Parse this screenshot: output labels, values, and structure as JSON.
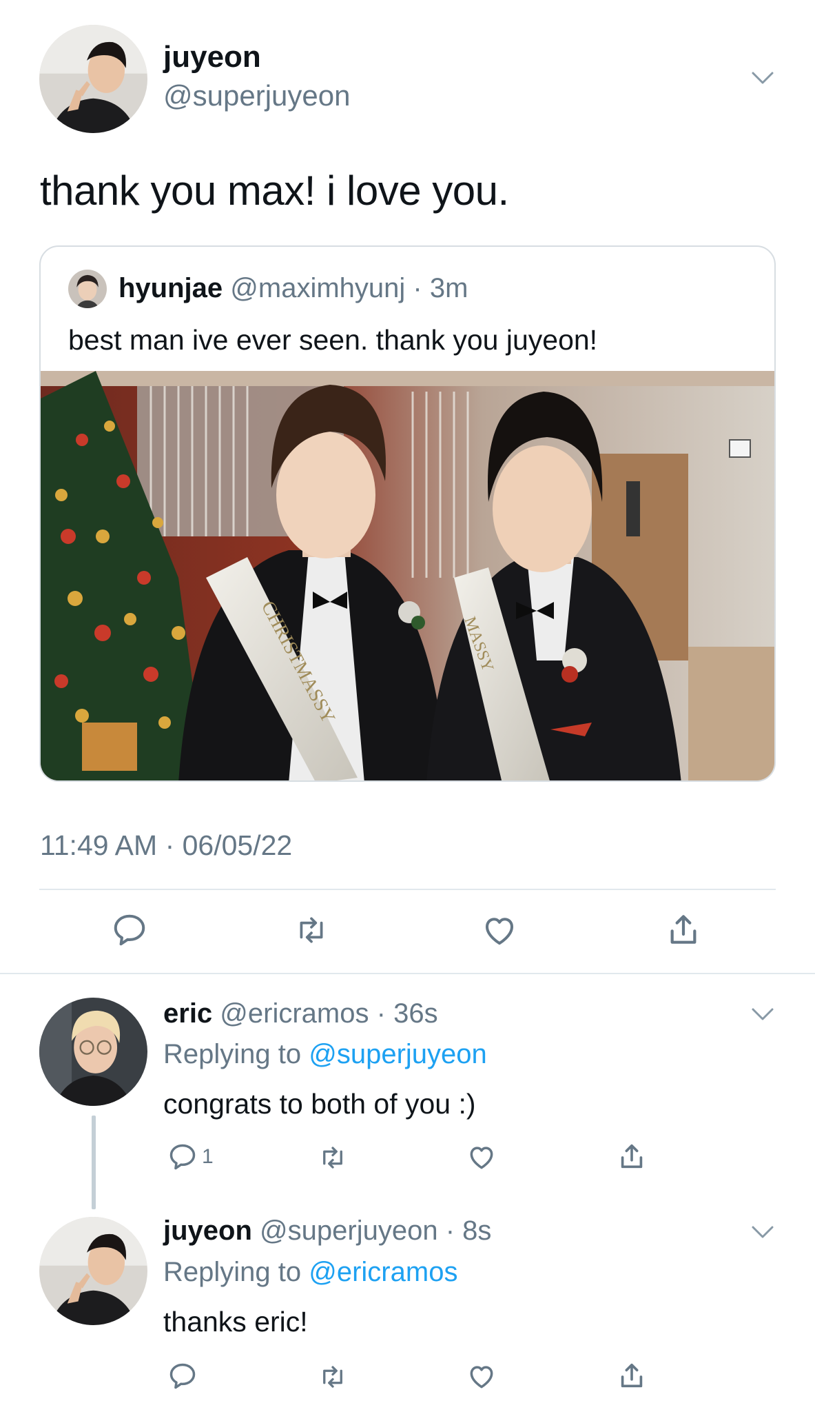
{
  "main_tweet": {
    "name": "juyeon",
    "handle": "@superjuyeon",
    "text": "thank you max! i love you.",
    "timestamp": "11:49 AM · 06/05/22",
    "avatar_icon": "avatar-photo"
  },
  "quoted_tweet": {
    "name": "hyunjae",
    "handle": "@maximhyunj",
    "separator": "·",
    "time": "3m",
    "text": "best man ive ever seen. thank you juyeon!",
    "photo": {
      "sash_text_left": "CHRISTMASSY",
      "sash_text_right": "MASSY"
    }
  },
  "actions": {
    "reply_icon": "reply-icon",
    "retweet_icon": "retweet-icon",
    "like_icon": "heart-icon",
    "share_icon": "share-icon"
  },
  "replies": [
    {
      "name": "eric",
      "handle": "@ericramos",
      "separator": "·",
      "time": "36s",
      "replying_label": "Replying to",
      "replying_to": "@superjuyeon",
      "text": "congrats to both of you :)",
      "reply_count": "1"
    },
    {
      "name": "juyeon",
      "handle": "@superjuyeon",
      "separator": "·",
      "time": "8s",
      "replying_label": "Replying to",
      "replying_to": "@ericramos",
      "text": "thanks eric!",
      "reply_count": ""
    }
  ],
  "colors": {
    "text": "#0f1419",
    "secondary": "#657786",
    "accent": "#1da1f2",
    "border": "#e1e8ed"
  }
}
